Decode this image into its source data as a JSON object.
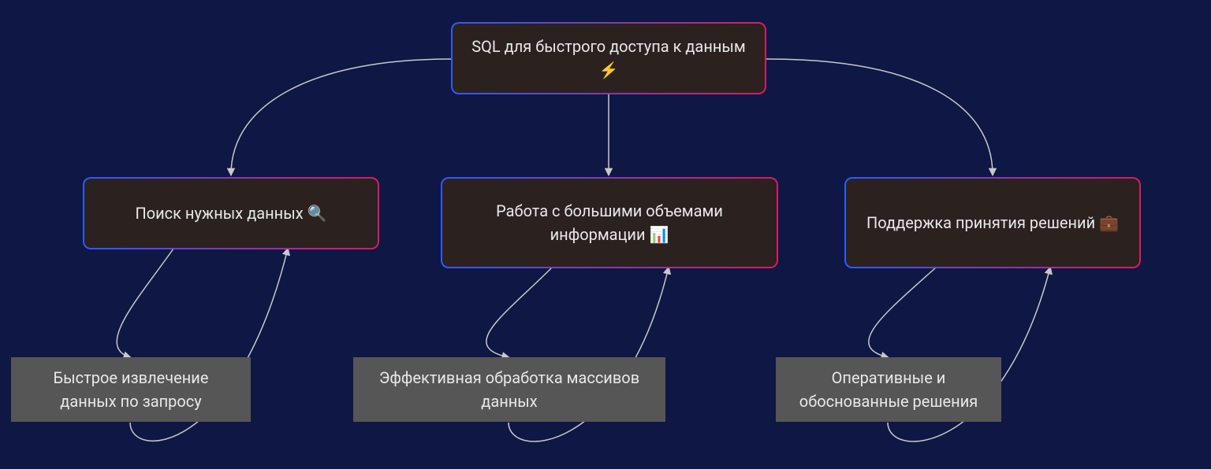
{
  "root": {
    "label": "SQL для быстрого доступа к данным ⚡"
  },
  "children": [
    {
      "label": "Поиск нужных данных 🔍",
      "leaf": "Быстрое извлечение данных по запросу"
    },
    {
      "label": "Работа с большими объемами информации 📊",
      "leaf": "Эффективная обработка массивов данных"
    },
    {
      "label": "Поддержка принятия решений 💼",
      "leaf": "Оперативные и обоснованные решения"
    }
  ],
  "colors": {
    "background": "#0f1744",
    "node_bg": "#2b2220",
    "leaf_bg": "#565656",
    "border_gradient_start": "#2b5bff",
    "border_gradient_end": "#d81b60",
    "connector": "#c9c9c9"
  }
}
